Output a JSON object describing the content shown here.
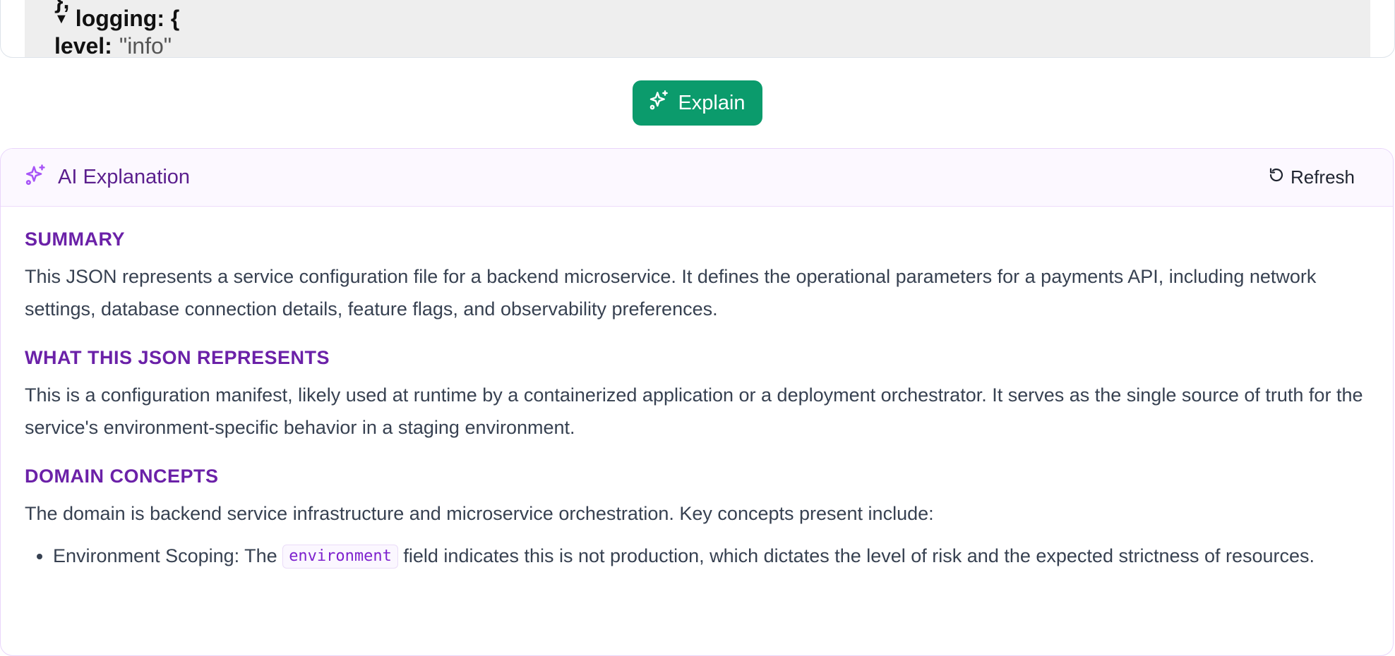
{
  "json_viewer": {
    "closing_line": "},",
    "logging_key": "logging: {",
    "level_key": "level:",
    "level_value": "\"info\""
  },
  "explain_button": {
    "label": "Explain",
    "icon": "sparkles-icon"
  },
  "ai_panel": {
    "title": "AI Explanation",
    "title_icon": "sparkles-icon",
    "refresh_label": "Refresh",
    "refresh_icon": "refresh-icon",
    "sections": [
      {
        "heading": "SUMMARY",
        "text": "This JSON represents a service configuration file for a backend microservice. It defines the operational parameters for a payments API, including network settings, database connection details, feature flags, and observability preferences."
      },
      {
        "heading": "WHAT THIS JSON REPRESENTS",
        "text": "This is a configuration manifest, likely used at runtime by a containerized application or a deployment orchestrator. It serves as the single source of truth for the service's environment-specific behavior in a staging environment."
      },
      {
        "heading": "DOMAIN CONCEPTS",
        "text": "The domain is backend service infrastructure and microservice orchestration. Key concepts present include:"
      }
    ],
    "bullets": [
      {
        "prefix": "Environment Scoping: The ",
        "code": "environment",
        "suffix": " field indicates this is not production, which dictates the level of risk and the expected strictness of resources."
      }
    ]
  },
  "colors": {
    "explain_button_bg": "#0b9b6c",
    "ai_heading": "#6b21a8",
    "ai_title": "#5b1f8e",
    "ai_accent_icon": "#a855f7"
  }
}
